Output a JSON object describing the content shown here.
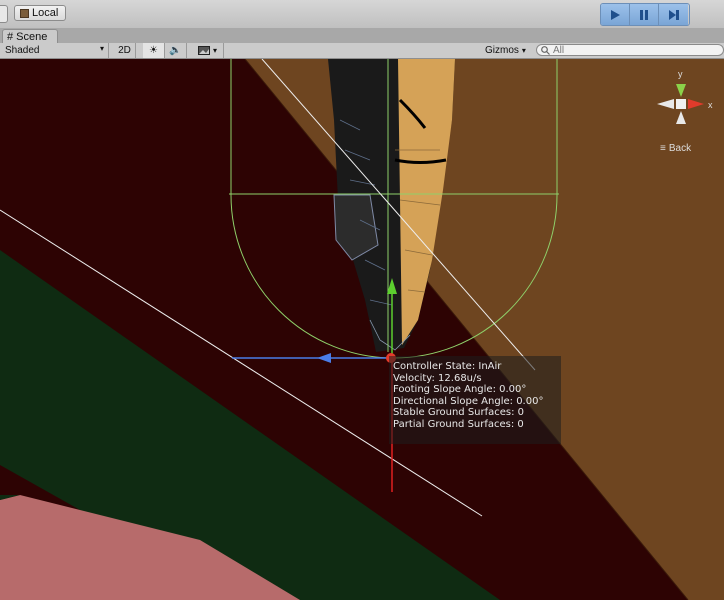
{
  "toolbar": {
    "pivot_label": "Local"
  },
  "tabs": {
    "scene_label": "Scene"
  },
  "scene_toolbar": {
    "shading_mode": "Shaded",
    "mode_2d_label": "2D",
    "gizmos_label": "Gizmos",
    "search_placeholder": "All"
  },
  "orientation_gizmo": {
    "axis_x_label": "x",
    "axis_y_label": "y",
    "view_label": "Back"
  },
  "controller_debug": {
    "state": "Controller State: InAir",
    "velocity": "Velocity: 12.68u/s",
    "footing_slope": "Footing Slope Angle: 0.00°",
    "directional_slope": "Directional Slope Angle: 0.00°",
    "stable_surfaces": "Stable Ground Surfaces: 0",
    "partial_surfaces": "Partial Ground Surfaces: 0"
  },
  "colors": {
    "ground_dark_red": "#2d0303",
    "slope_orange": "#6e4520",
    "green_plane": "#0f2b12",
    "pink_plane": "#b76b6b",
    "play_blue": "#7aa5d6"
  }
}
